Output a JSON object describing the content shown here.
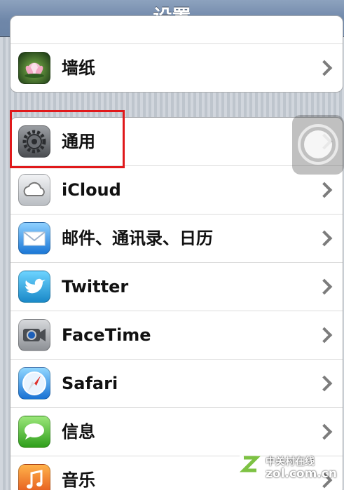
{
  "nav": {
    "title": "设置"
  },
  "groups": [
    {
      "items": [
        {
          "label": "墙纸",
          "icon": "wallpaper-icon"
        }
      ]
    },
    {
      "items": [
        {
          "label": "通用",
          "icon": "gear-icon"
        },
        {
          "label": "iCloud",
          "icon": "cloud-icon"
        },
        {
          "label": "邮件、通讯录、日历",
          "icon": "mail-envelope-icon"
        },
        {
          "label": "Twitter",
          "icon": "twitter-bird-icon"
        },
        {
          "label": "FaceTime",
          "icon": "video-camera-icon"
        },
        {
          "label": "Safari",
          "icon": "compass-icon"
        },
        {
          "label": "信息",
          "icon": "speech-bubble-icon"
        },
        {
          "label": "音乐",
          "icon": "music-note-icon"
        }
      ]
    }
  ],
  "watermark": {
    "line1": "中关村在线",
    "line2": "zol.com.cn"
  }
}
